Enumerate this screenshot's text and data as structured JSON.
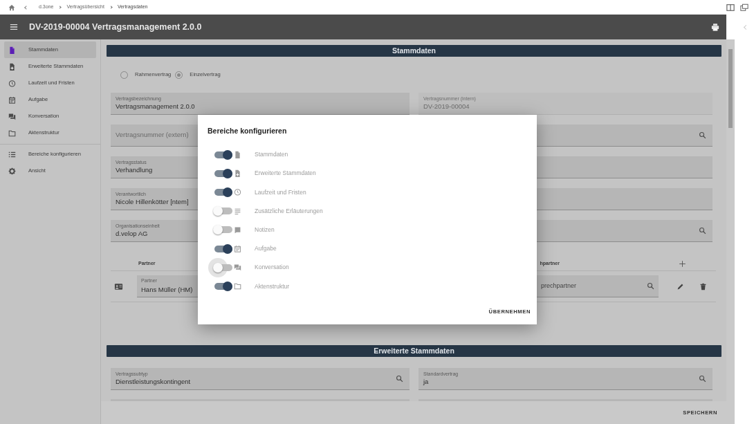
{
  "breadcrumbs": [
    "d.3one",
    "Vertragsübersicht",
    "Vertragsdaten"
  ],
  "header": {
    "title": "DV-2019-00004 Vertragsmanagement 2.0.0"
  },
  "sidebar": {
    "groups": [
      {
        "items": [
          {
            "label": "Stammdaten",
            "selected": true
          },
          {
            "label": "Erweiterte Stammdaten",
            "selected": false
          },
          {
            "label": "Laufzeit und Fristen",
            "selected": false
          },
          {
            "label": "Aufgabe",
            "selected": false
          },
          {
            "label": "Konversation",
            "selected": false
          },
          {
            "label": "Aktenstruktur",
            "selected": false
          }
        ]
      },
      {
        "items": [
          {
            "label": "Bereiche konfigurieren",
            "selected": false
          },
          {
            "label": "Ansicht",
            "selected": false
          }
        ]
      }
    ]
  },
  "stammdaten": {
    "title": "Stammdaten",
    "radios": [
      {
        "label": "Rahmenvertrag",
        "selected": false
      },
      {
        "label": "Einzelvertrag",
        "selected": true
      }
    ],
    "fields": [
      {
        "label": "Vertragsbezeichnung",
        "value": "Vertragsmanagement 2.0.0",
        "search": false,
        "disabled": false
      },
      {
        "label": "Vertragsnummer (intern)",
        "value": "DV-2019-00004",
        "search": false,
        "disabled": true
      },
      {
        "placeholder": "Vertragsnummer (extern)",
        "search": false,
        "disabled": false
      },
      {
        "search": true,
        "disabled": false
      },
      {
        "label": "Vertragsstatus",
        "value": "Verhandlung",
        "search": false,
        "disabled": false
      },
      {
        "search": false,
        "disabled": false
      },
      {
        "label": "Verantwortlich",
        "value": "Nicole Hillenkötter [ntem]",
        "search": false,
        "disabled": false
      },
      {
        "search": false,
        "disabled": false
      },
      {
        "label": "Organisationseinheit",
        "value": "d.velop AG",
        "search": false,
        "disabled": false
      },
      {
        "search": true,
        "disabled": false
      }
    ],
    "partner_table": {
      "columns": [
        "Partner",
        "hpartner"
      ],
      "rows": [
        {
          "partner_label": "Partner",
          "partner": "Hans Müller (HM)",
          "contact_placeholder": "prechpartner"
        }
      ]
    }
  },
  "erweiterte": {
    "title": "Erweiterte Stammdaten",
    "fields": [
      {
        "label": "Vertragssubtyp",
        "value": "Dienstleistungskontingent",
        "search": true,
        "disabled": false
      },
      {
        "label": "Standardvertrag",
        "value": "ja",
        "search": true,
        "disabled": false
      }
    ]
  },
  "save_button": "SPEICHERN",
  "dialog": {
    "title": "Bereiche konfigurieren",
    "items": [
      {
        "label": "Stammdaten",
        "on": true,
        "focused": false
      },
      {
        "label": "Erweiterte Stammdaten",
        "on": true,
        "focused": false
      },
      {
        "label": "Laufzeit und Fristen",
        "on": true,
        "focused": false
      },
      {
        "label": "Zusätzliche Erläuterungen",
        "on": false,
        "focused": false
      },
      {
        "label": "Notizen",
        "on": false,
        "focused": false
      },
      {
        "label": "Aufgabe",
        "on": true,
        "focused": false
      },
      {
        "label": "Konversation",
        "on": false,
        "focused": true
      },
      {
        "label": "Aktenstruktur",
        "on": true,
        "focused": false
      }
    ],
    "button": "ÜBERNEHMEN"
  }
}
